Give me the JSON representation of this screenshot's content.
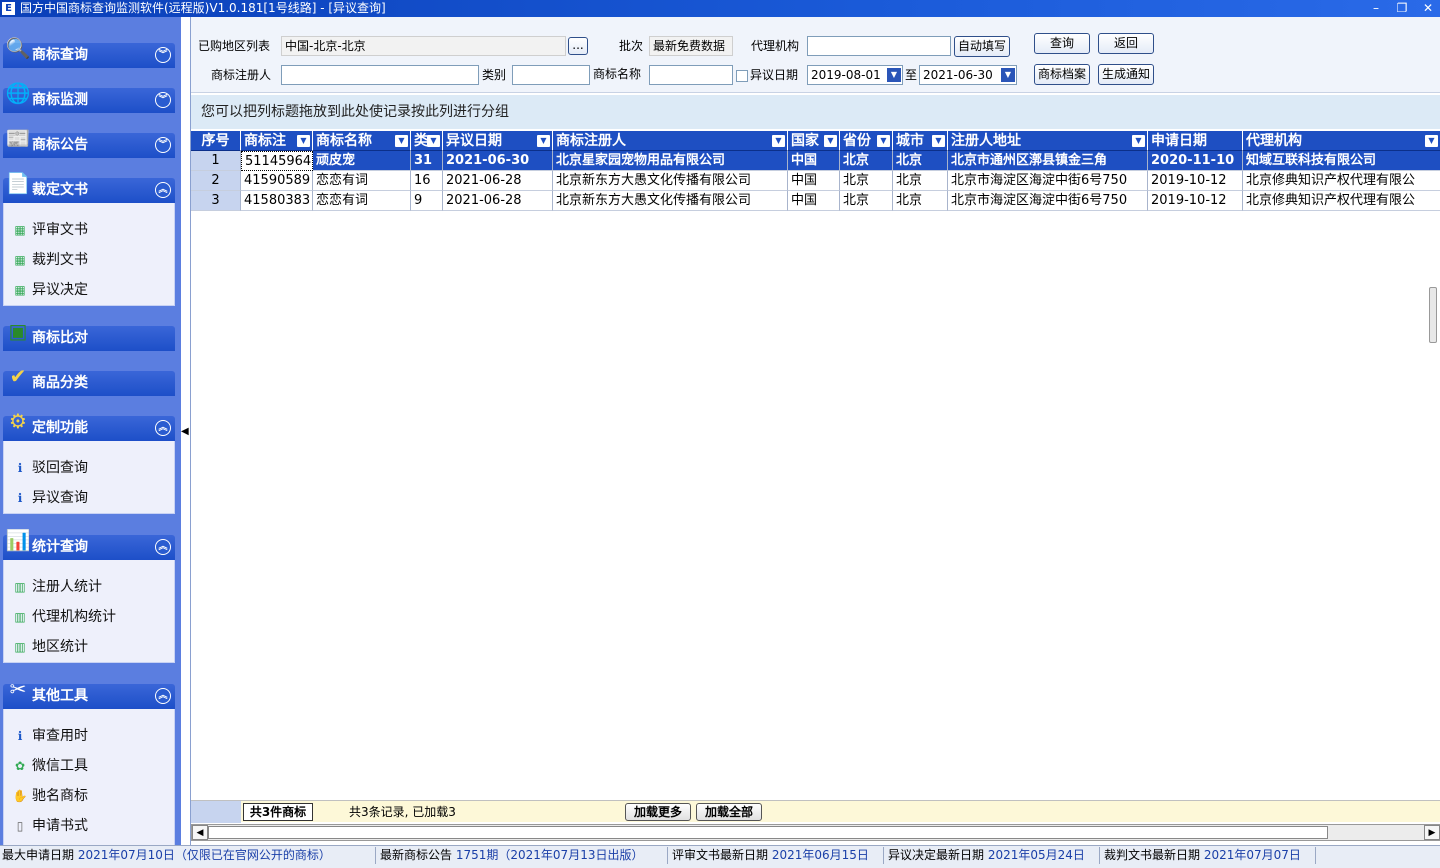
{
  "window": {
    "title": "国方中国商标查询监测软件(远程版)V1.0.181[1号线路] - [异议查询]",
    "app_icon": "E"
  },
  "sidebar": {
    "groups": [
      {
        "label": "商标查询",
        "icon": "🔍",
        "expanded": false,
        "items": []
      },
      {
        "label": "商标监测",
        "icon": "🌐",
        "expanded": false,
        "items": []
      },
      {
        "label": "商标公告",
        "icon": "📰",
        "expanded": false,
        "items": []
      },
      {
        "label": "裁定文书",
        "icon": "📄",
        "expanded": true,
        "items": [
          {
            "label": "评审文书",
            "icon": "▦"
          },
          {
            "label": "裁判文书",
            "icon": "▦"
          },
          {
            "label": "异议决定",
            "icon": "▦"
          }
        ]
      },
      {
        "label": "商标比对",
        "icon": "▣",
        "expanded": false,
        "items": []
      },
      {
        "label": "商品分类",
        "icon": "✔",
        "expanded": false,
        "items": []
      },
      {
        "label": "定制功能",
        "icon": "⚙",
        "expanded": true,
        "items": [
          {
            "label": "驳回查询",
            "icon": "ℹ"
          },
          {
            "label": "异议查询",
            "icon": "ℹ"
          }
        ]
      },
      {
        "label": "统计查询",
        "icon": "📊",
        "expanded": true,
        "items": [
          {
            "label": "注册人统计",
            "icon": "▥"
          },
          {
            "label": "代理机构统计",
            "icon": "▥"
          },
          {
            "label": "地区统计",
            "icon": "▥"
          }
        ]
      },
      {
        "label": "其他工具",
        "icon": "✂",
        "expanded": true,
        "items": [
          {
            "label": "审查用时",
            "icon": "ℹ"
          },
          {
            "label": "微信工具",
            "icon": "✿"
          },
          {
            "label": "驰名商标",
            "icon": "✋"
          },
          {
            "label": "申请书式",
            "icon": "▯"
          }
        ]
      }
    ]
  },
  "form": {
    "region_label": "已购地区列表",
    "region_value": "中国-北京-北京",
    "region_btn": "...",
    "batch_label": "批次",
    "batch_value": "最新免费数据",
    "agency_label": "代理机构",
    "agency_value": "",
    "autofill_btn": "自动填写",
    "query_btn": "查询",
    "back_btn": "返回",
    "registrant_label": "商标注册人",
    "registrant_value": "",
    "class_label": "类别",
    "class_value": "",
    "tmname_label": "商标名称",
    "tmname_value": "",
    "opp_date_label": "异议日期",
    "date_from": "2019-08-01",
    "date_to_label": "至",
    "date_to": "2021-06-30",
    "archive_btn": "商标档案",
    "notice_btn": "生成通知"
  },
  "group_hint": "您可以把列标题拖放到此处使记录按此列进行分组",
  "grid": {
    "columns": [
      "序号",
      "商标注",
      "商标名称",
      "类",
      "异议日期",
      "商标注册人",
      "国家",
      "省份",
      "城市",
      "注册人地址",
      "申请日期",
      "代理机构"
    ],
    "rows": [
      [
        "1",
        "51145964",
        "顽皮宠",
        "31",
        "2021-06-30",
        "北京星家园宠物用品有限公司",
        "中国",
        "北京",
        "北京",
        "北京市通州区漷县镇金三角",
        "2020-11-10",
        "知域互联科技有限公司"
      ],
      [
        "2",
        "41590589",
        "恋恋有词",
        "16",
        "2021-06-28",
        "北京新东方大愚文化传播有限公司",
        "中国",
        "北京",
        "北京",
        "北京市海淀区海淀中街6号750",
        "2019-10-12",
        "北京修典知识产权代理有限公"
      ],
      [
        "3",
        "41580383",
        "恋恋有词",
        "9",
        "2021-06-28",
        "北京新东方大愚文化传播有限公司",
        "中国",
        "北京",
        "北京",
        "北京市海淀区海淀中街6号750",
        "2019-10-12",
        "北京修典知识产权代理有限公"
      ]
    ],
    "footer_count": "共3件商标",
    "footer_status": "共3条记录, 已加载3",
    "load_more": "加载更多",
    "load_all": "加载全部"
  },
  "statusbar": {
    "items": [
      {
        "label": "最大申请日期",
        "value": "2021年07月10日（仅限已在官网公开的商标）"
      },
      {
        "label": "最新商标公告",
        "value": "1751期（2021年07月13日出版）"
      },
      {
        "label": "评审文书最新日期",
        "value": "2021年06月15日"
      },
      {
        "label": "异议决定最新日期",
        "value": "2021年05月24日"
      },
      {
        "label": "裁判文书最新日期",
        "value": "2021年07月07日"
      }
    ]
  },
  "colors": {
    "titlebar": "#0a3fb8",
    "sidebar_bg": "#5b7ee0",
    "header_blue": "#1e4fc2",
    "group_hint_bg": "#dceaf6"
  }
}
